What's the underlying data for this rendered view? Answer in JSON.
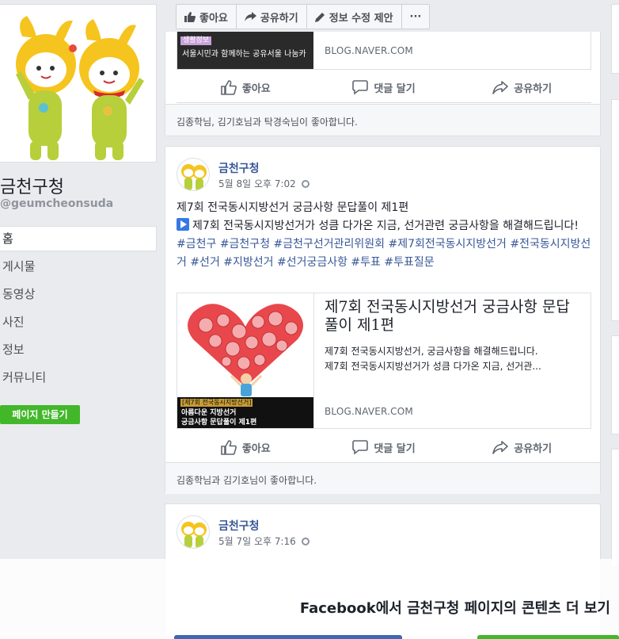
{
  "page": {
    "name": "금천구청",
    "handle": "@geumcheonsuda"
  },
  "nav": {
    "items": [
      "홈",
      "게시물",
      "동영상",
      "사진",
      "정보",
      "커뮤니티"
    ],
    "create_page": "페이지 만들기"
  },
  "topbar": {
    "like": "좋아요",
    "share": "공유하기",
    "suggest_edit": "정보 수정 제안",
    "more": "···"
  },
  "actions": {
    "like": "좋아요",
    "comment": "댓글 달기",
    "share": "공유하기"
  },
  "posts": [
    {
      "link": {
        "image_tag": "생활정보",
        "image_text": "서울시민과 함께하는 공유서울 나눔카",
        "domain": "BLOG.NAVER.COM"
      },
      "likes": "김종학님, 김기호님과 탁경숙님이 좋아합니다."
    },
    {
      "author": "금천구청",
      "time": "5월 8일 오후 7:02",
      "title_line": "제7회 전국동시지방선거 궁금사항 문답풀이 제1편",
      "body_line": "제7회 전국동시지방선거가 성큼 다가온 지금, 선거관련 궁금사항을 해결해드립니다!",
      "hashtags": "#금천구 #금천구청 #금천구선거관리위원회 #제7회전국동시지방선거 #전국동시지방선거 #선거 #지방선거 #선거궁금사항 #투표 #투표질문",
      "link": {
        "title": "제7회 전국동시지방선거 궁금사항 문답풀이 제1편",
        "desc1": "제7회 전국동시지방선거, 궁금사항을 해결해드립니다.",
        "desc2": "제7회 전국동시지방선거가 성큼 다가온 지금, 선거관...",
        "domain": "BLOG.NAVER.COM",
        "caption_tag": "[제7회 전국동시지방선거]",
        "caption_line1": "아름다운 지방선거",
        "caption_line2": "궁금사항 문답풀이 제1편"
      },
      "likes": "김종학님과 김기호님이 좋아합니다."
    },
    {
      "author": "금천구청",
      "time": "5월 7일 오후 7:16"
    }
  ],
  "overlay": {
    "text": "Facebook에서 금천구청 페이지의 콘텐츠 더 보기"
  }
}
